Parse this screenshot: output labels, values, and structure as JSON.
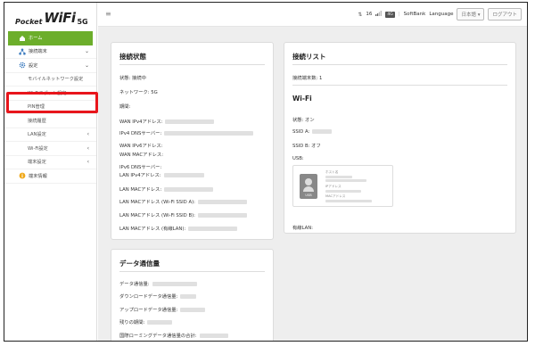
{
  "logo": {
    "small": "Pocket",
    "big": "WiFi",
    "suffix": "5G"
  },
  "sidebar": {
    "items": [
      {
        "label": "ホーム",
        "chev": ""
      },
      {
        "label": "接続端末",
        "chev": "⌄"
      },
      {
        "label": "設定",
        "chev": "⌄"
      },
      {
        "label": "モバイルネットワーク設定",
        "chev": ""
      },
      {
        "label": "Wi-Fiスポット設定",
        "chev": ""
      },
      {
        "label": "PIN管理",
        "chev": ""
      },
      {
        "label": "接続履歴",
        "chev": ""
      },
      {
        "label": "LAN設定",
        "chev": "‹"
      },
      {
        "label": "Wi-Fi設定",
        "chev": "‹"
      },
      {
        "label": "端末設定",
        "chev": "‹"
      },
      {
        "label": "端末情報",
        "chev": ""
      }
    ]
  },
  "topbar": {
    "menu_icon": "≡",
    "signal_text": "16",
    "network_badge": "4G",
    "carrier": "SoftBank",
    "separator": "|",
    "language_label": "Language",
    "language_value": "日本語 ▾",
    "logout_label": "ログアウト"
  },
  "connection_status": {
    "title": "接続状態",
    "rows": [
      {
        "label": "状態: 接続中",
        "blur": 0
      },
      {
        "label": "ネットワーク: 5G",
        "blur": 0
      },
      {
        "label": "期間:",
        "blur": 0
      },
      {
        "label": "WAN IPv4アドレス:",
        "blur": 55
      },
      {
        "label": "IPv4 DNSサーバー:",
        "blur": 100
      },
      {
        "label": "WAN IPv6アドレス:",
        "blur": 0
      },
      {
        "label": "WAN MACアドレス:",
        "blur": 0
      },
      {
        "label": "IPv6 DNSサーバー:",
        "blur": 0
      },
      {
        "label": "LAN IPv4アドレス:",
        "blur": 45
      },
      {
        "label": "LAN MACアドレス:",
        "blur": 55
      },
      {
        "label": "LAN MACアドレス (Wi-Fi SSID A):",
        "blur": 55
      },
      {
        "label": "LAN MACアドレス (Wi-Fi SSID B):",
        "blur": 55
      },
      {
        "label": "LAN MACアドレス (有線LAN):",
        "blur": 55
      }
    ]
  },
  "connection_list": {
    "title": "接続リスト",
    "count_label": "接続端末数: 1"
  },
  "wifi": {
    "title": "Wi-Fi",
    "rows": [
      {
        "label": "状態: オン",
        "blur": 0
      },
      {
        "label": "SSID A:",
        "blur": 22
      },
      {
        "label": "SSID B: オフ",
        "blur": 0
      },
      {
        "label": "USB:",
        "blur": 0
      }
    ],
    "wired_label": "有線LAN:"
  },
  "usb_card": {
    "icon_label": "USB",
    "host_label": "ホスト名",
    "ip_label": "IPアドレス",
    "mac_label": "MACアドレス"
  },
  "data_usage": {
    "title": "データ通信量",
    "rows": [
      {
        "label": "データ通信量:",
        "blur": 50
      },
      {
        "label": "ダウンロードデータ通信量:",
        "blur": 18
      },
      {
        "label": "アップロードデータ通信量:",
        "blur": 28
      },
      {
        "label": "残りの期間:",
        "blur": 28
      },
      {
        "label": "国際ローミングデータ通信量の合計:",
        "blur": 32
      }
    ]
  }
}
